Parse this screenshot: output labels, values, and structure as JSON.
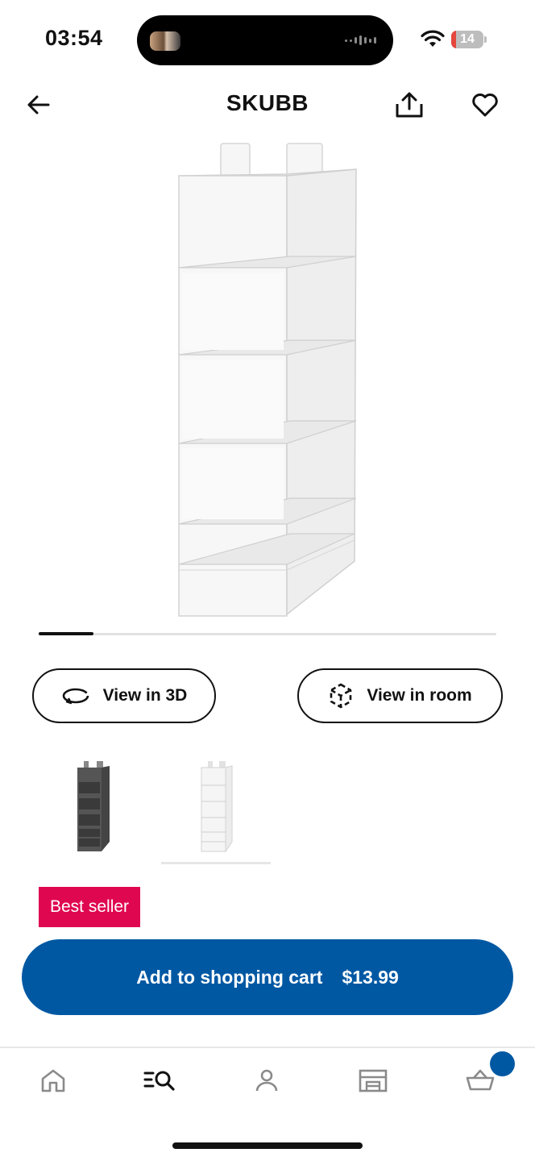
{
  "status_bar": {
    "time": "03:54",
    "battery_level": "14",
    "battery_fraction": 0.14,
    "wifi_icon": "wifi-icon"
  },
  "header": {
    "title": "SKUBB",
    "back_icon": "arrow-left-icon",
    "share_icon": "share-icon",
    "favorite_icon": "heart-icon"
  },
  "gallery": {
    "progress_fraction": 0.12
  },
  "actions": {
    "view_3d_label": "View in 3D",
    "view_3d_icon": "rotate-3d-icon",
    "view_room_label": "View in room",
    "view_room_icon": "ar-cube-icon"
  },
  "variants": [
    {
      "color": "#4a4a4a",
      "selected": false
    },
    {
      "color": "#f2f2f2",
      "selected": true
    }
  ],
  "badge": {
    "label": "Best seller",
    "color": "#e00751"
  },
  "cart_button": {
    "label": "Add to shopping cart",
    "price": "$13.99",
    "color": "#0058a3"
  },
  "tab_bar": {
    "items": [
      {
        "icon": "home-icon"
      },
      {
        "icon": "search-list-icon",
        "active": true
      },
      {
        "icon": "profile-icon"
      },
      {
        "icon": "store-icon"
      },
      {
        "icon": "cart-icon",
        "has_notification": true
      }
    ]
  }
}
